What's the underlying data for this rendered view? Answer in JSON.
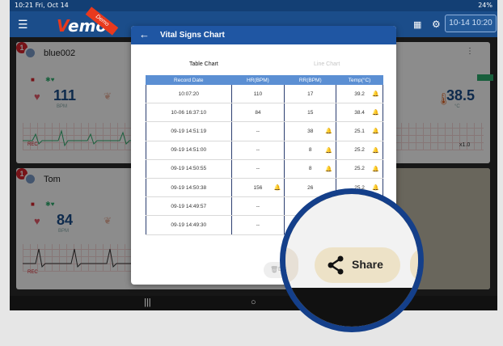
{
  "status_bar": {
    "left": "10:21  Fri, Oct 14",
    "right": "24%"
  },
  "app": {
    "logo": "emo",
    "logo_v": "V",
    "demo": "Demo",
    "datetime": "10-14 10:20"
  },
  "patients": [
    {
      "badge": "1",
      "name": "blue002",
      "hr": "111",
      "unit": "BPM",
      "temp": "38.5",
      "temp_unit": "°C",
      "speed": "x1.0",
      "rec": "REC"
    },
    {
      "badge": "1",
      "name": "Tom",
      "hr": "84",
      "unit": "BPM",
      "rec": "REC"
    }
  ],
  "dialog": {
    "title": "Vital Signs Chart",
    "tabs": {
      "table": "Table Chart",
      "line": "Line Chart"
    },
    "columns": [
      "Record Date",
      "HR(BPM)",
      "RR(BPM)",
      "Temp(°C)"
    ],
    "rows": [
      {
        "date": "10:07:20",
        "hr": "110",
        "hr_alert": false,
        "rr": "17",
        "rr_alert": false,
        "temp": "39.2",
        "temp_alert": true
      },
      {
        "date": "10-06 16:37:10",
        "hr": "84",
        "hr_alert": false,
        "rr": "15",
        "rr_alert": false,
        "temp": "38.4",
        "temp_alert": true
      },
      {
        "date": "09-19 14:51:19",
        "hr": "--",
        "hr_alert": false,
        "rr": "38",
        "rr_alert": true,
        "temp": "25.1",
        "temp_alert": true
      },
      {
        "date": "09-19 14:51:00",
        "hr": "--",
        "hr_alert": false,
        "rr": "8",
        "rr_alert": true,
        "temp": "25.2",
        "temp_alert": true
      },
      {
        "date": "09-19 14:50:55",
        "hr": "--",
        "hr_alert": false,
        "rr": "8",
        "rr_alert": true,
        "temp": "25.2",
        "temp_alert": true
      },
      {
        "date": "09-19 14:50:38",
        "hr": "156",
        "hr_alert": true,
        "rr": "26",
        "rr_alert": false,
        "temp": "25.2",
        "temp_alert": true
      },
      {
        "date": "09-19 14:49:57",
        "hr": "--",
        "hr_alert": false,
        "rr": "37",
        "rr_alert": false,
        "temp": "",
        "temp_alert": false
      },
      {
        "date": "09-19 14:49:30",
        "hr": "--",
        "hr_alert": false,
        "rr": "",
        "rr_alert": false,
        "temp": "",
        "temp_alert": false
      }
    ],
    "delete_label": "De",
    "share_label": "Share"
  },
  "colors": {
    "brand": "#1b4d8a",
    "header": "#1f56a3",
    "alert": "#d9232d",
    "magnifier_ring": "#143f8a"
  }
}
